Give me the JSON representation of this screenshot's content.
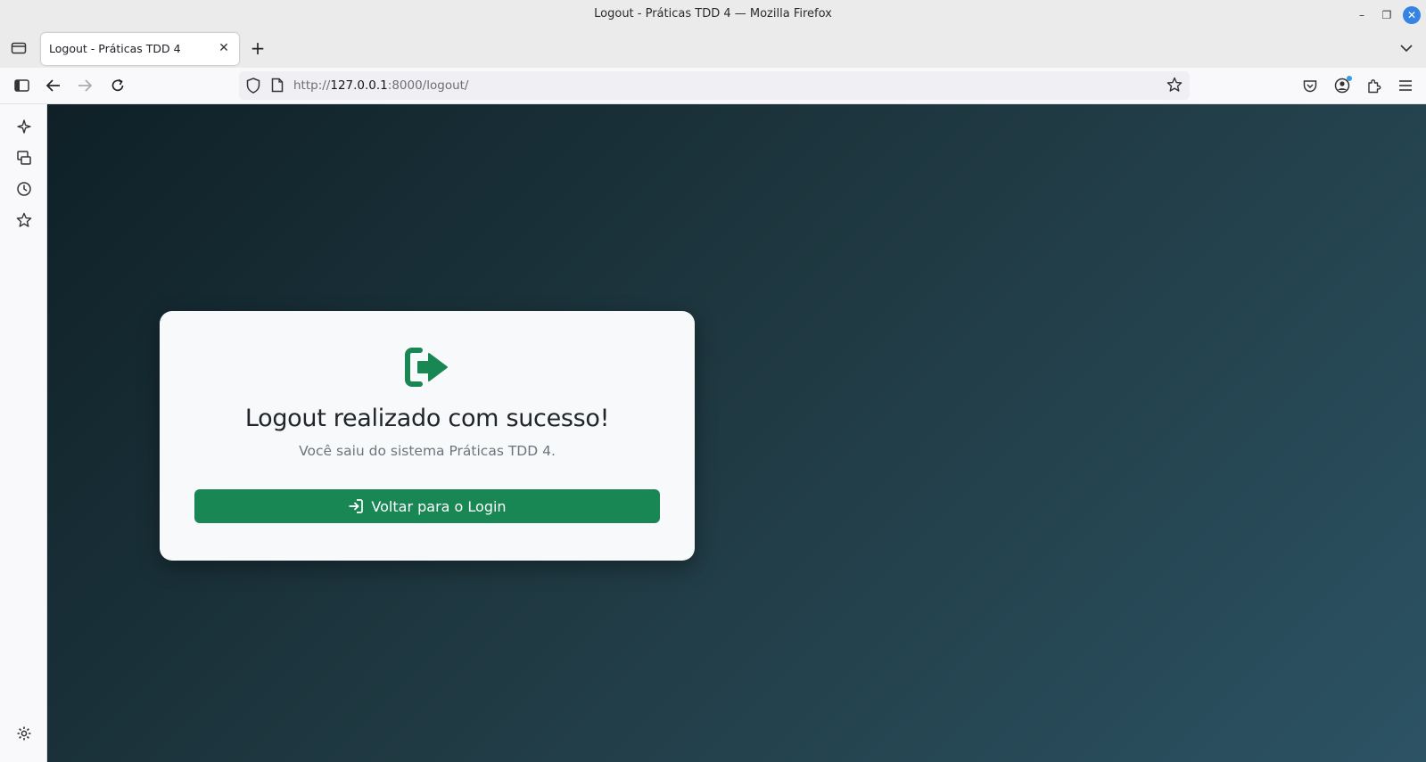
{
  "window": {
    "title": "Logout - Práticas TDD 4 — Mozilla Firefox",
    "controls": {
      "minimize": "–",
      "maximize": "❐",
      "close": "✕"
    }
  },
  "tabs": {
    "active_tab_label": "Logout - Práticas TDD 4",
    "close_glyph": "✕",
    "new_tab_glyph": "+"
  },
  "navbar": {
    "url_prefix": "http://",
    "url_host": "127.0.0.1",
    "url_rest": ":8000/logout/"
  },
  "card": {
    "heading": "Logout realizado com sucesso!",
    "subtext": "Você saiu do sistema Práticas TDD 4.",
    "button_label": "Voltar para o Login"
  },
  "colors": {
    "accent_green": "#198754",
    "gradient": [
      "#0f2027",
      "#203a43",
      "#2c5364"
    ],
    "card_bg": "#f8f9fa"
  },
  "icons": {
    "sidebar": [
      "ai-chatbot-icon",
      "synced-tabs-icon",
      "history-icon",
      "bookmarks-icon",
      "settings-icon"
    ],
    "toolbar": [
      "sidebar-toggle-icon",
      "back-icon",
      "forward-icon",
      "reload-icon",
      "pocket-icon",
      "account-icon",
      "extensions-icon",
      "menu-icon"
    ]
  }
}
